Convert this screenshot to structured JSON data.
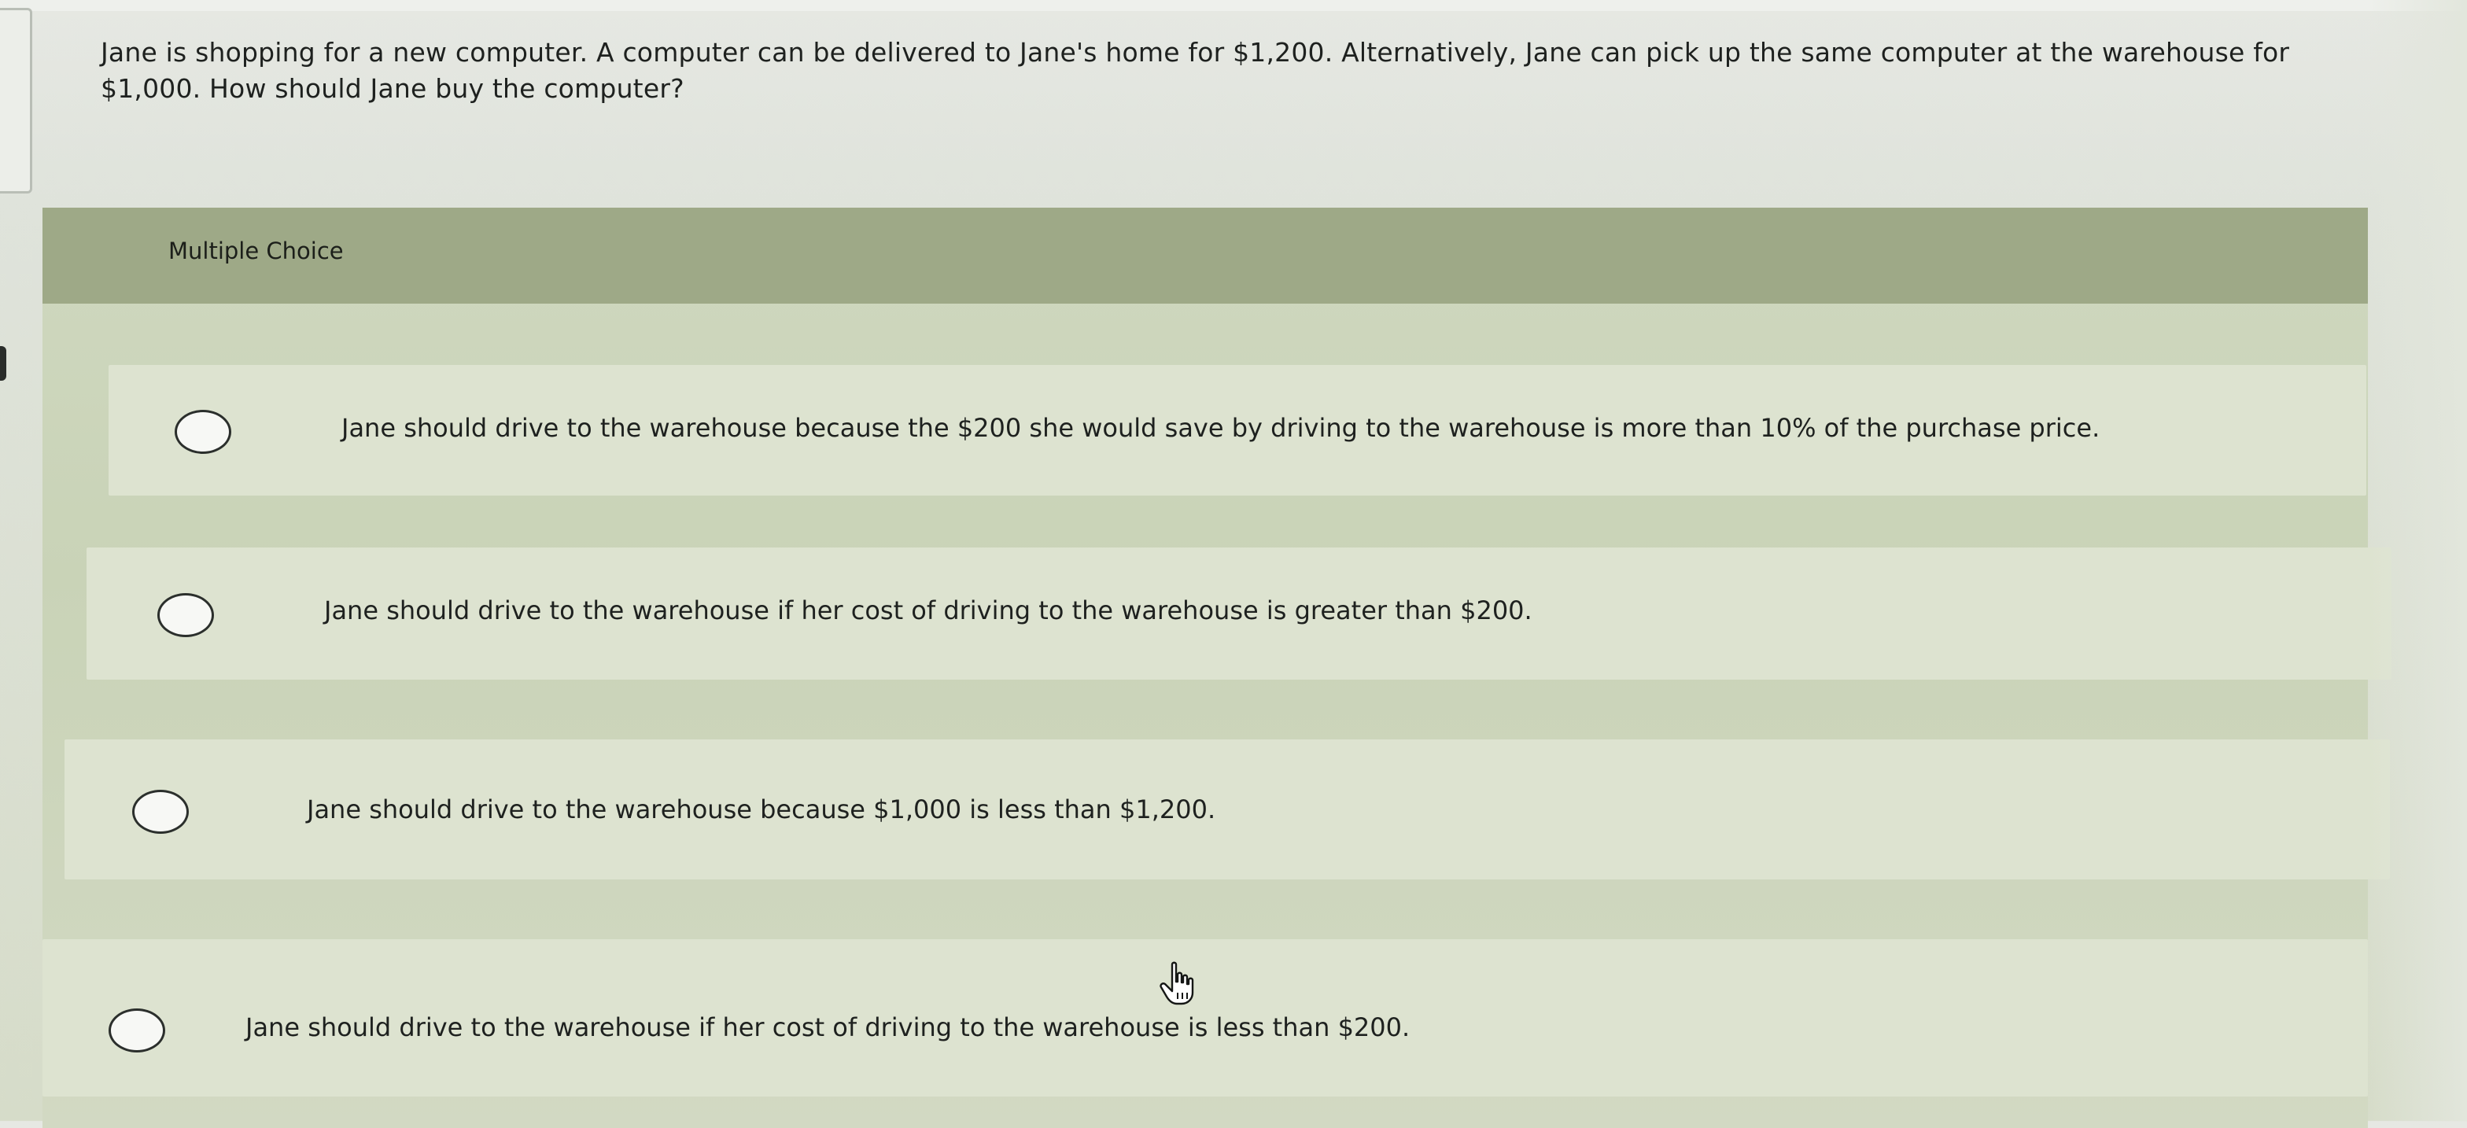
{
  "question": {
    "text": "Jane is shopping for a new computer. A computer can be delivered to Jane's home for $1,200. Alternatively, Jane can pick up the same computer at the warehouse for $1,000. How should Jane buy the computer?"
  },
  "multiple_choice": {
    "title": "Multiple Choice",
    "options": [
      {
        "label": "Jane should drive to the warehouse because the $200 she would save by driving to the warehouse is more than 10% of the purchase price.",
        "selected": false
      },
      {
        "label": "Jane should drive to the warehouse if her cost of driving to the warehouse is greater than $200.",
        "selected": false
      },
      {
        "label": "Jane should drive to the warehouse because $1,000 is less than $1,200.",
        "selected": false
      },
      {
        "label": "Jane should drive to the warehouse if her cost of driving to the warehouse is less than $200.",
        "selected": false
      }
    ]
  },
  "cursor": {
    "icon": "hand-pointer-icon"
  }
}
